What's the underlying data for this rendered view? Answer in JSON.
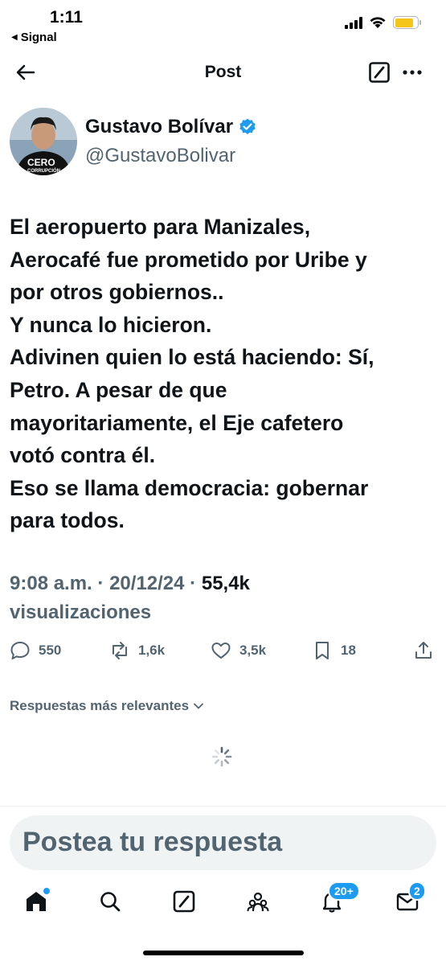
{
  "status_bar": {
    "time": "1:11",
    "back_app": "Signal",
    "battery_level": 0.85
  },
  "header": {
    "title": "Post"
  },
  "author": {
    "name": "Gustavo Bolívar",
    "handle": "@GustavoBolivar",
    "verified": true,
    "avatar_text": "CERO",
    "avatar_subtext": "CORRUPCIÓN"
  },
  "tweet": {
    "text": "El aeropuerto para Manizales,\nAerocafé fue prometido por Uribe y\npor otros gobiernos..\nY nunca lo hicieron.\nAdivinen quien lo está haciendo: Sí,\nPetro.  A pesar de que\nmayoritariamente, el Eje cafetero\nvotó contra él.\nEso se llama democracia: gobernar\npara todos.",
    "time": "9:08 a.m.",
    "date": "20/12/24",
    "sep": "·",
    "views_count": "55,4k",
    "views_label": "visualizaciones"
  },
  "actions": {
    "replies": "550",
    "reposts": "1,6k",
    "likes": "3,5k",
    "bookmarks": "18"
  },
  "replies_sort": {
    "label": "Respuestas más relevantes"
  },
  "reply_box": {
    "placeholder": "Postea tu respuesta"
  },
  "tabbar": {
    "notifications_badge": "20+",
    "messages_badge": "2"
  },
  "colors": {
    "accent": "#1d9bf0",
    "text": "#0f1419",
    "secondary": "#536471",
    "battery": "#f5c518"
  }
}
